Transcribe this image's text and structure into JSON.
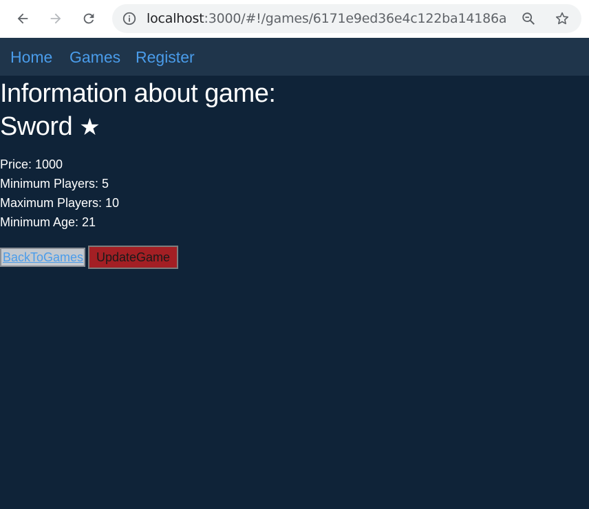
{
  "browser": {
    "url_host": "localhost",
    "url_path": ":3000/#!/games/6171e9ed36e4c122ba14186a"
  },
  "nav": {
    "home": "Home",
    "games": "Games",
    "register": "Register"
  },
  "game": {
    "heading": "Information about game:",
    "name": "Sword",
    "star": "★",
    "price": "Price: 1000",
    "min_players": "Minimum Players: 5",
    "max_players": "Maximum Players: 10",
    "min_age": "Minimum Age: 21"
  },
  "actions": {
    "back": "BackToGames",
    "update": "UpdateGame"
  },
  "colors": {
    "page_bg": "#0f2338",
    "navbar_bg": "#1f354b",
    "link": "#4a9cea",
    "update_button": "#a31f24"
  },
  "icons": [
    "back-arrow-icon",
    "forward-arrow-icon",
    "reload-icon",
    "info-icon",
    "zoom-icon",
    "bookmark-star-icon"
  ]
}
